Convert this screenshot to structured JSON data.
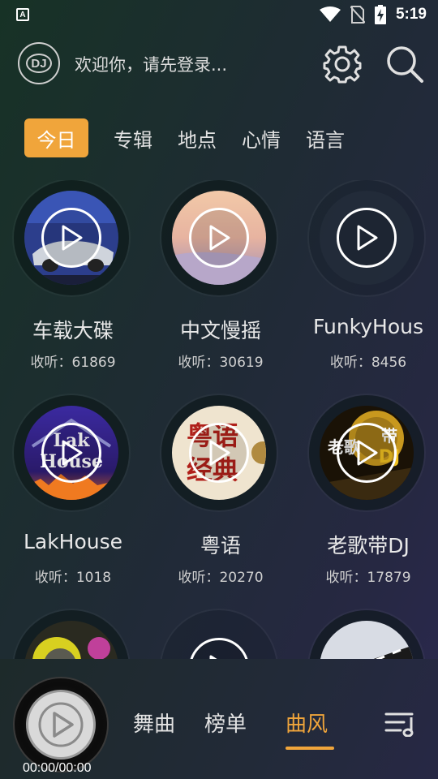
{
  "status_bar": {
    "left_icon": "A",
    "time": "5:19",
    "icons": [
      "wifi-icon",
      "no-sim-icon",
      "battery-charging-icon"
    ]
  },
  "header": {
    "logo": "DJ",
    "welcome": "欢迎你，请先登录...",
    "icons": [
      "settings-icon",
      "search-icon"
    ]
  },
  "tabs": [
    {
      "label": "今日",
      "active": true
    },
    {
      "label": "专辑",
      "active": false
    },
    {
      "label": "地点",
      "active": false
    },
    {
      "label": "心情",
      "active": false
    },
    {
      "label": "语言",
      "active": false
    }
  ],
  "cards": [
    {
      "title": "车载大碟",
      "count": "收听：61869"
    },
    {
      "title": "中文慢摇",
      "count": "收听：30619"
    },
    {
      "title": "FunkyHous",
      "count": "收听：8456"
    },
    {
      "title": "LakHouse",
      "count": "收听：1018"
    },
    {
      "title": "粤语",
      "count": "收听：20270"
    },
    {
      "title": "老歌带DJ",
      "count": "收听：17879"
    }
  ],
  "cover_art_text": {
    "lakhouse_line1": "Lak",
    "lakhouse_line2": "House",
    "yueyu_line1": "粤语",
    "yueyu_line2": "经典",
    "laoge_line1": "老歌",
    "laoge_line2": "带",
    "laoge_line3": "DJ"
  },
  "player": {
    "time": "00:00/00:00"
  },
  "bottom_tabs": [
    {
      "label": "舞曲",
      "active": false
    },
    {
      "label": "榜单",
      "active": false
    },
    {
      "label": "曲风",
      "active": true
    }
  ],
  "colors": {
    "accent": "#f0a53b",
    "background": "#1f2b34"
  }
}
